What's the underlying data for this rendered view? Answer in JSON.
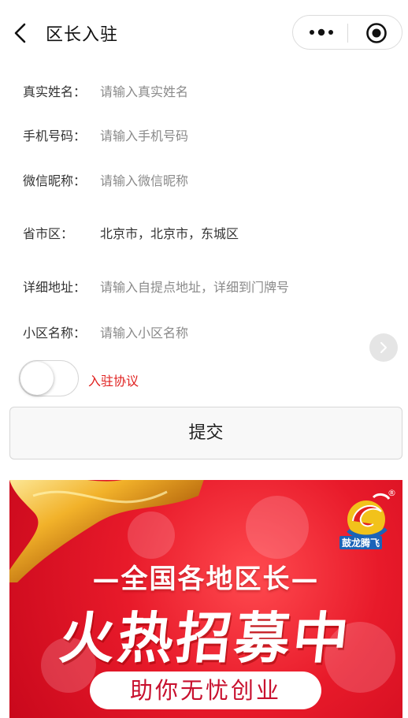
{
  "header": {
    "title": "区长入驻",
    "icons": {
      "back": "back-arrow-icon",
      "more": "more-dots-icon",
      "close": "mini-program-close-icon"
    }
  },
  "form": {
    "rows": [
      {
        "label": "真实姓名：",
        "placeholder": "请输入真实姓名"
      },
      {
        "label": "手机号码：",
        "placeholder": "请输入手机号码"
      },
      {
        "label": "微信昵称：",
        "placeholder": "请输入微信昵称"
      },
      {
        "label": "省市区：",
        "value": "北京市，北京市，东城区"
      },
      {
        "label": "详细地址：",
        "placeholder": "请输入自提点地址，详细到门牌号"
      },
      {
        "label": "小区名称：",
        "placeholder": "请输入小区名称"
      }
    ],
    "agreement_label": "入驻协议",
    "agreement_checked": false,
    "submit_label": "提交"
  },
  "banner": {
    "subtitle": "—全国各地区长—",
    "headline": "火热招募中",
    "pill_text": "助你无忧创业",
    "logo_text": "鼓龙腾飞",
    "registered_mark": "®",
    "colors": {
      "background": "#e81a2a",
      "pill_text": "#c8102e"
    }
  },
  "colors": {
    "accent_red": "#e0201f",
    "placeholder_gray": "#8a8a8a"
  }
}
